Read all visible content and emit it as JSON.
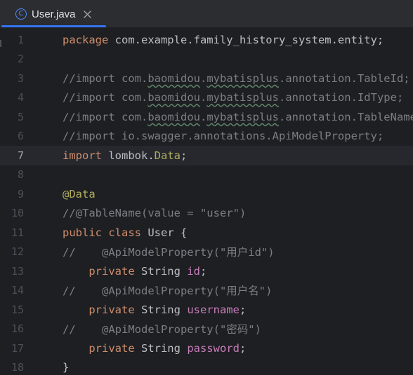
{
  "tab": {
    "icon": "class-icon",
    "icon_glyph": "C",
    "label": "User.java",
    "close_icon": "close-icon"
  },
  "editor": {
    "current_line": 7,
    "lines": [
      {
        "num": "1",
        "segments": [
          {
            "t": "package ",
            "c": "kw"
          },
          {
            "t": "com.example.family_history_system.entity;",
            "c": "plain"
          }
        ]
      },
      {
        "num": "2",
        "segments": []
      },
      {
        "num": "3",
        "segments": [
          {
            "t": "//import com.",
            "c": "cmt"
          },
          {
            "t": "baomidou",
            "c": "cmt",
            "u": true
          },
          {
            "t": ".",
            "c": "cmt"
          },
          {
            "t": "mybatisplus",
            "c": "cmt",
            "u": true
          },
          {
            "t": ".annotation.TableId;",
            "c": "cmt"
          }
        ]
      },
      {
        "num": "4",
        "segments": [
          {
            "t": "//import com.",
            "c": "cmt"
          },
          {
            "t": "baomidou",
            "c": "cmt",
            "u": true
          },
          {
            "t": ".",
            "c": "cmt"
          },
          {
            "t": "mybatisplus",
            "c": "cmt",
            "u": true
          },
          {
            "t": ".annotation.IdType;",
            "c": "cmt"
          }
        ]
      },
      {
        "num": "5",
        "segments": [
          {
            "t": "//import com.",
            "c": "cmt"
          },
          {
            "t": "baomidou",
            "c": "cmt",
            "u": true
          },
          {
            "t": ".",
            "c": "cmt"
          },
          {
            "t": "mybatisplus",
            "c": "cmt",
            "u": true
          },
          {
            "t": ".annotation.TableName;",
            "c": "cmt"
          }
        ]
      },
      {
        "num": "6",
        "segments": [
          {
            "t": "//import io.swagger.annotations.ApiModelProperty;",
            "c": "cmt"
          }
        ]
      },
      {
        "num": "7",
        "segments": [
          {
            "t": "import ",
            "c": "kw"
          },
          {
            "t": "lombok.",
            "c": "plain"
          },
          {
            "t": "Data",
            "c": "ann"
          },
          {
            "t": ";",
            "c": "plain"
          }
        ]
      },
      {
        "num": "8",
        "segments": []
      },
      {
        "num": "9",
        "segments": [
          {
            "t": "@Data",
            "c": "ann"
          }
        ]
      },
      {
        "num": "10",
        "segments": [
          {
            "t": "//@TableName(value = \"user\")",
            "c": "cmt"
          }
        ]
      },
      {
        "num": "11",
        "segments": [
          {
            "t": "public class ",
            "c": "kw"
          },
          {
            "t": "User {",
            "c": "plain"
          }
        ]
      },
      {
        "num": "12",
        "segments": [
          {
            "t": "//    @ApiModelProperty(\"用户id\")",
            "c": "cmt"
          }
        ]
      },
      {
        "num": "13",
        "segments": [
          {
            "t": "    private ",
            "c": "kw"
          },
          {
            "t": "String ",
            "c": "plain"
          },
          {
            "t": "id",
            "c": "fld"
          },
          {
            "t": ";",
            "c": "plain"
          }
        ]
      },
      {
        "num": "14",
        "segments": [
          {
            "t": "//    @ApiModelProperty(\"用户名\")",
            "c": "cmt"
          }
        ]
      },
      {
        "num": "15",
        "segments": [
          {
            "t": "    private ",
            "c": "kw"
          },
          {
            "t": "String ",
            "c": "plain"
          },
          {
            "t": "username",
            "c": "fld"
          },
          {
            "t": ";",
            "c": "plain"
          }
        ]
      },
      {
        "num": "16",
        "segments": [
          {
            "t": "//    @ApiModelProperty(\"密码\")",
            "c": "cmt"
          }
        ]
      },
      {
        "num": "17",
        "segments": [
          {
            "t": "    private ",
            "c": "kw"
          },
          {
            "t": "String ",
            "c": "plain"
          },
          {
            "t": "password",
            "c": "fld"
          },
          {
            "t": ";",
            "c": "plain"
          }
        ]
      },
      {
        "num": "18",
        "segments": [
          {
            "t": "}",
            "c": "plain"
          }
        ]
      }
    ]
  },
  "colors": {
    "editor_bg": "#1e1f22",
    "tab_bar_bg": "#2b2d30",
    "tab_underline": "#3574f0",
    "keyword": "#cf8e6d",
    "comment": "#7a7e85",
    "annotation": "#b3ae60",
    "field": "#c77dbb",
    "text": "#bcbec4",
    "line_number": "#4b5059"
  }
}
